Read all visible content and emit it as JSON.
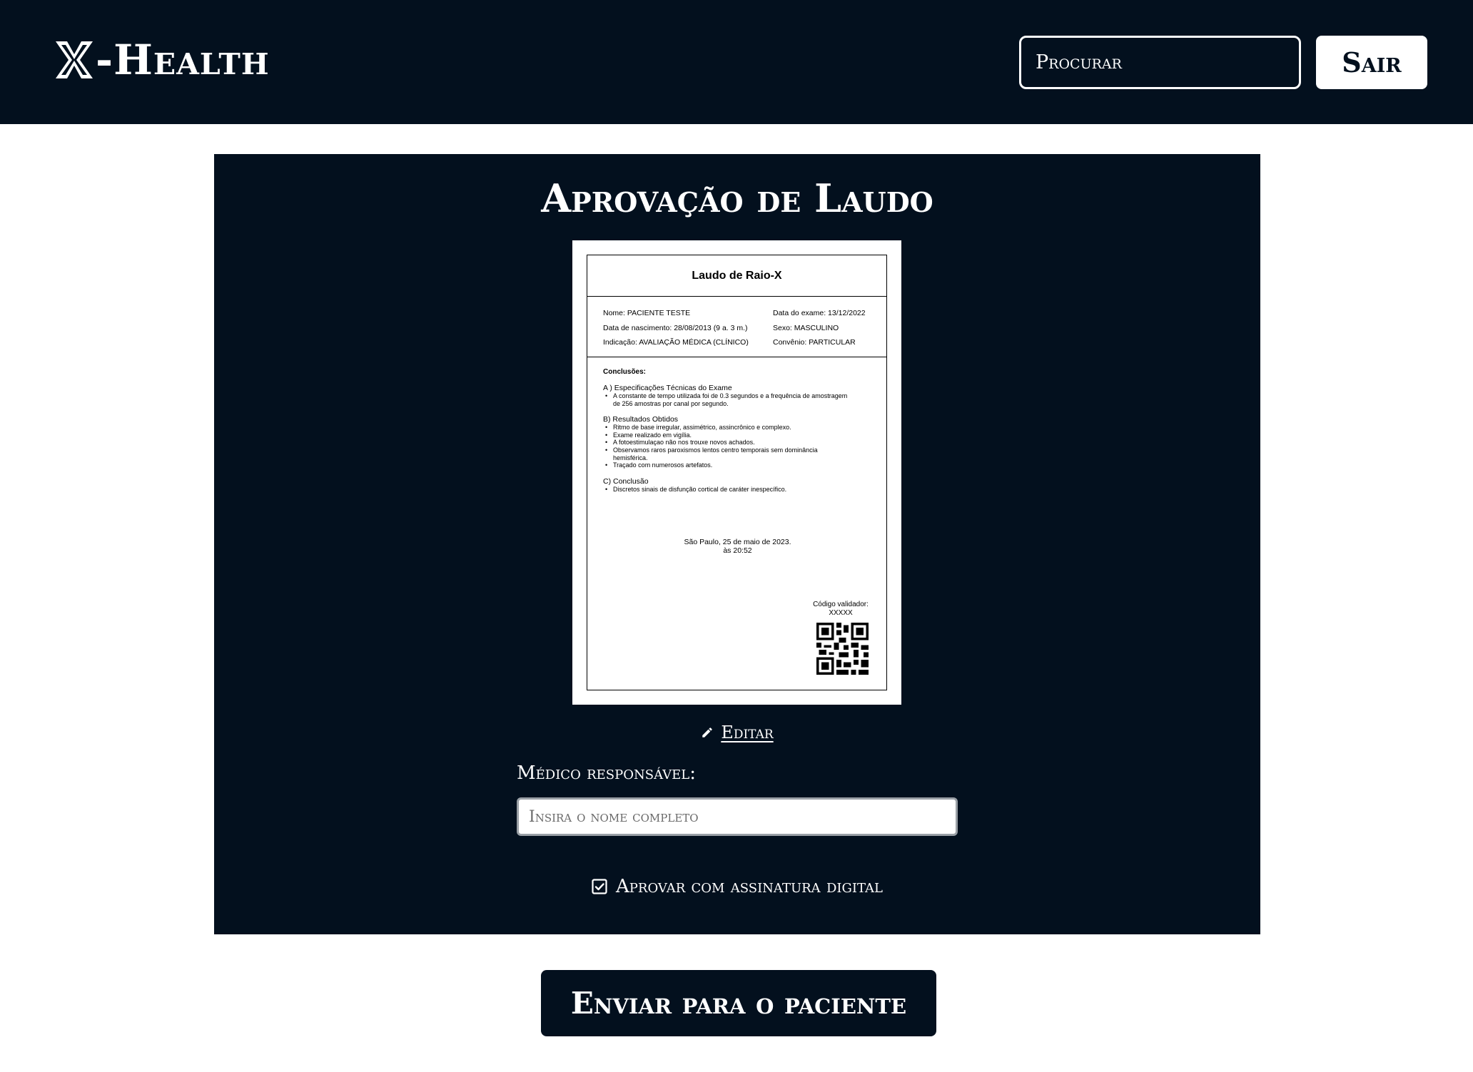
{
  "header": {
    "logo_text": "-Health",
    "search_placeholder": "Procurar",
    "logout_label": "Sair"
  },
  "panel": {
    "title": "Aprovação de Laudo",
    "edit_label": "Editar",
    "doctor_label": "Médico responsável:",
    "doctor_placeholder": "Insira o nome completo",
    "sign_label": "Aprovar com assinatura digital",
    "sign_checked": true
  },
  "report": {
    "title": "Laudo de Raio-X",
    "info_left": [
      "Nome: PACIENTE TESTE",
      "Data de nascimento: 28/08/2013 (9 a. 3 m.)",
      "Indicação: AVALIAÇÃO MÉDICA (CLÍNICO)"
    ],
    "info_right": [
      "Data do exame: 13/12/2022",
      "Sexo: MASCULINO",
      "Convênio: PARTICULAR"
    ],
    "conclusions_title": "Conclusões:",
    "sections": [
      {
        "heading": "A ) Especificações Técnicas do Exame",
        "items": [
          "A constante de tempo utilizada foi de 0.3 segundos e a frequência de amostragem de 256 amostras por canal por segundo."
        ]
      },
      {
        "heading": "B) Resultados Obtidos",
        "items": [
          "Ritmo de base irregular, assimétrico, assincrônico e complexo.",
          "Exame realizado em vigília.",
          "A fotoestimulaçao não nos trouxe novos achados.",
          "Observamos raros paroxismos lentos centro temporais sem dominância hemisférica.",
          "Traçado com numerosos artefatos."
        ]
      },
      {
        "heading": "C) Conclusão",
        "items": [
          "Discretos sinais de disfunção cortical de caráter inespecífico."
        ]
      }
    ],
    "place_date": "São Paulo, 25 de maio de 2023.",
    "time": "às 20:52",
    "validator_label": "Código validador:",
    "validator_code": "XXXXX"
  },
  "footer": {
    "send_label": "Enviar para o paciente"
  },
  "colors": {
    "navy": "#03101e",
    "white": "#ffffff"
  },
  "icons": [
    "x-logo-icon",
    "pencil-icon",
    "checkbox-checked-icon",
    "qr-code-icon"
  ]
}
